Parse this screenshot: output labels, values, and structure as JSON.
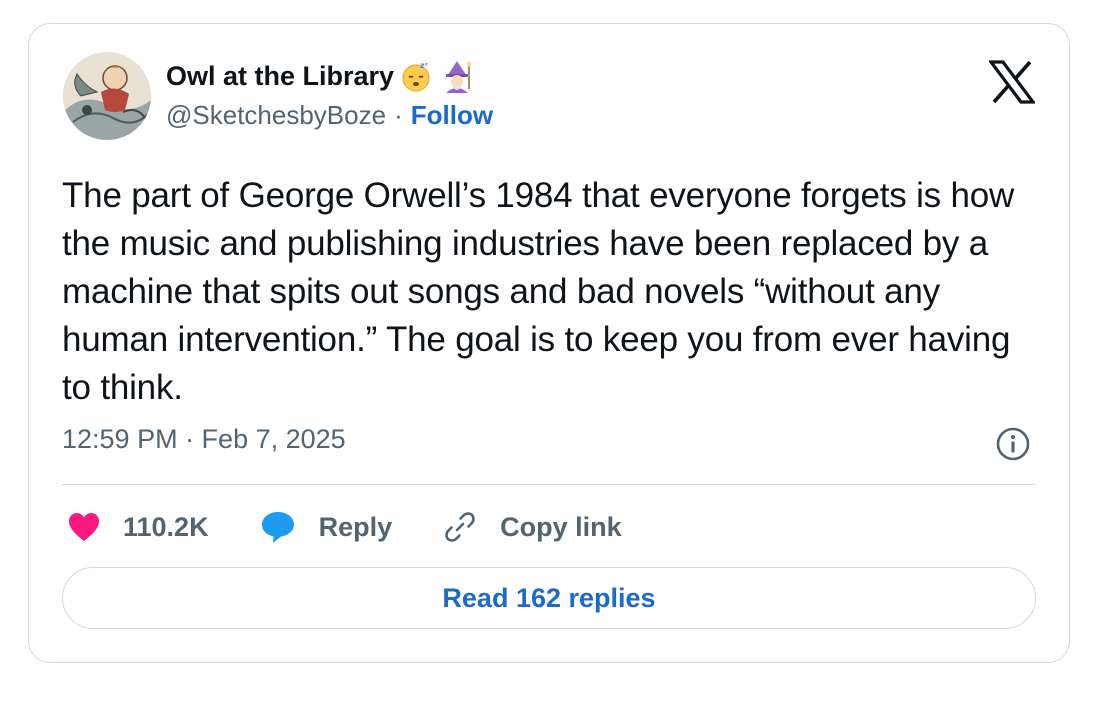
{
  "author": {
    "display_name": "Owl at the Library",
    "handle": "@SketchesbyBoze",
    "separator": "·",
    "follow_label": "Follow",
    "emoji_names": [
      "sleeping-face-emoji",
      "woman-mage-emoji"
    ]
  },
  "tweet": {
    "text": "The part of George Orwell’s 1984 that everyone forgets is how the music and publishing industries have been replaced by a machine that spits out songs and bad novels “without any human intervention.” The goal is to keep you from ever having to think.",
    "timestamp": "12:59 PM · Feb 7, 2025"
  },
  "actions": {
    "likes_label": "110.2K",
    "reply_label": "Reply",
    "copy_link_label": "Copy link"
  },
  "footer": {
    "read_replies_label": "Read 162 replies"
  },
  "icons": {
    "logo": "x-logo-icon",
    "info": "info-icon",
    "heart": "heart-icon",
    "reply": "speech-bubble-icon",
    "link": "link-icon"
  },
  "colors": {
    "link_blue": "#1b6bc9",
    "heart_pink": "#f91880",
    "reply_blue": "#1d9bf0",
    "muted_gray": "#536471",
    "border": "#cfd9de"
  }
}
